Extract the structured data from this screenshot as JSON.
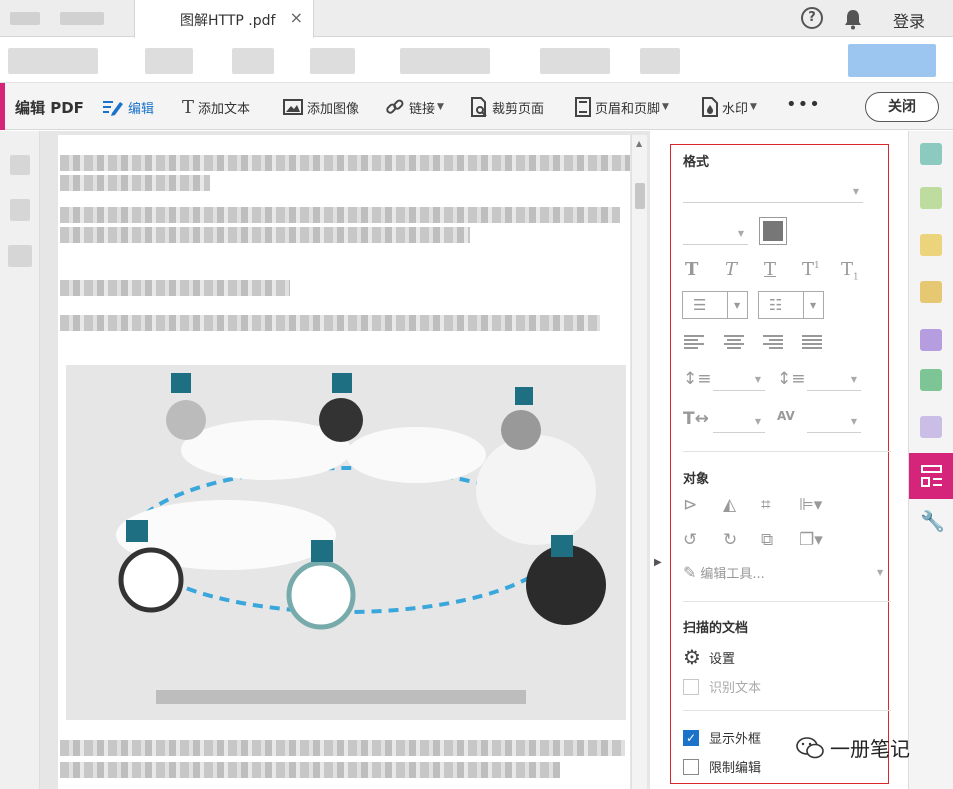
{
  "tab": {
    "title": "图解HTTP .pdf",
    "close": "×"
  },
  "window": {
    "help": "?",
    "login": "登录"
  },
  "toolbar": {
    "title": "编辑 PDF",
    "items": [
      {
        "label": "编辑",
        "icon": "edit-text-icon",
        "active": true
      },
      {
        "label": "添加文本",
        "icon": "add-text-icon"
      },
      {
        "label": "添加图像",
        "icon": "add-image-icon"
      },
      {
        "label": "链接",
        "icon": "link-icon",
        "dropdown": true
      },
      {
        "label": "裁剪页面",
        "icon": "crop-page-icon"
      },
      {
        "label": "页眉和页脚",
        "icon": "header-footer-icon",
        "dropdown": true
      },
      {
        "label": "水印",
        "icon": "watermark-icon",
        "dropdown": true
      }
    ],
    "more": "•••",
    "close": "关闭"
  },
  "panel": {
    "format_title": "格式",
    "color": "#777777",
    "object_title": "对象",
    "edit_tools": "编辑工具...",
    "scanned_title": "扫描的文档",
    "settings": "设置",
    "recognize_text": "识别文本",
    "show_bbox": "显示外框",
    "restrict_edit": "限制编辑",
    "show_bbox_checked": true,
    "restrict_edit_checked": false
  },
  "watermark_text": "一册笔记",
  "colors": {
    "accent": "#d4257a",
    "active": "#1a73c9",
    "panel_border": "#d9262f"
  }
}
